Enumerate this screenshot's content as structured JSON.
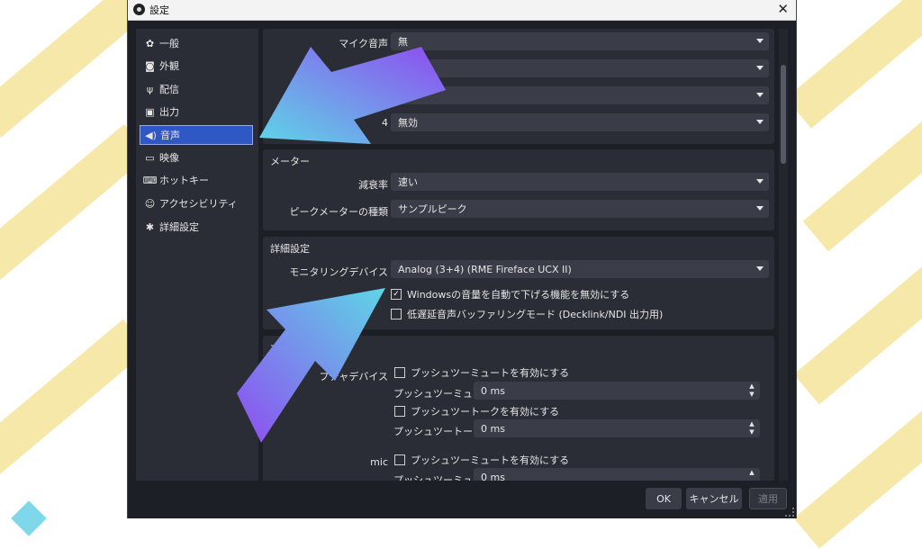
{
  "window": {
    "title": "設定",
    "close_glyph": "✕"
  },
  "sidebar": {
    "items": [
      {
        "label": "一般",
        "icon": "gear-icon",
        "glyph": "✿"
      },
      {
        "label": "外観",
        "icon": "appearance-icon",
        "glyph": "◙"
      },
      {
        "label": "配信",
        "icon": "broadcast-icon",
        "glyph": "ψ"
      },
      {
        "label": "出力",
        "icon": "output-icon",
        "glyph": "▣"
      },
      {
        "label": "音声",
        "icon": "speaker-icon",
        "glyph": "◀)"
      },
      {
        "label": "映像",
        "icon": "monitor-icon",
        "glyph": "▭"
      },
      {
        "label": "ホットキー",
        "icon": "keyboard-icon",
        "glyph": "⌨"
      },
      {
        "label": "アクセシビリティ",
        "icon": "accessibility-icon",
        "glyph": "☺"
      },
      {
        "label": "詳細設定",
        "icon": "wrench-icon",
        "glyph": "✱"
      }
    ],
    "active_index": 4
  },
  "audio_devices": {
    "mic_label": "マイク音声",
    "mic_value": "無",
    "rows_hidden_values": [
      "",
      ""
    ],
    "mic4_label_partial": "4",
    "mic4_value": "無効"
  },
  "meters": {
    "title": "メーター",
    "decay_label": "減衰率",
    "decay_value": "速い",
    "peak_label": "ピークメーターの種類",
    "peak_value": "サンプルピーク"
  },
  "advanced": {
    "title": "詳細設定",
    "monitoring_label": "モニタリングデバイス",
    "monitoring_value": "Analog (3+4) (RME Fireface UCX II)",
    "ducking_label": "Windowsの音量を自動で下げる機能を無効にする",
    "ducking_checked": true,
    "lowlatency_label": "低遅延音声バッファリングモード (Decklink/NDI 出力用)",
    "lowlatency_checked": false
  },
  "hotkeys": {
    "title_partial": "ホット",
    "device1_label_partial": "プチャデバイス",
    "ptm_enable": "プッシュツーミュートを有効にする",
    "ptm_delay_label": "プッシュツーミュート遅延",
    "ptm_delay_value": "0 ms",
    "ptt_enable": "プッシュツートークを有効にする",
    "ptt_delay_label": "プッシュツートーク遅延",
    "ptt_delay_value": "0 ms",
    "device2_label": "mic",
    "ptm2_enable": "プッシュツーミュートを有効にする",
    "ptm2_delay_label": "プッシュツーミュート遅延",
    "ptm2_delay_value": "0 ms"
  },
  "buttons": {
    "ok": "OK",
    "cancel": "キャンセル",
    "apply": "適用"
  },
  "colors": {
    "accent": "#2f58c4",
    "arrow_start": "#5ed6e6",
    "arrow_end": "#8f4cf0",
    "stripe": "#f6e7a3"
  }
}
